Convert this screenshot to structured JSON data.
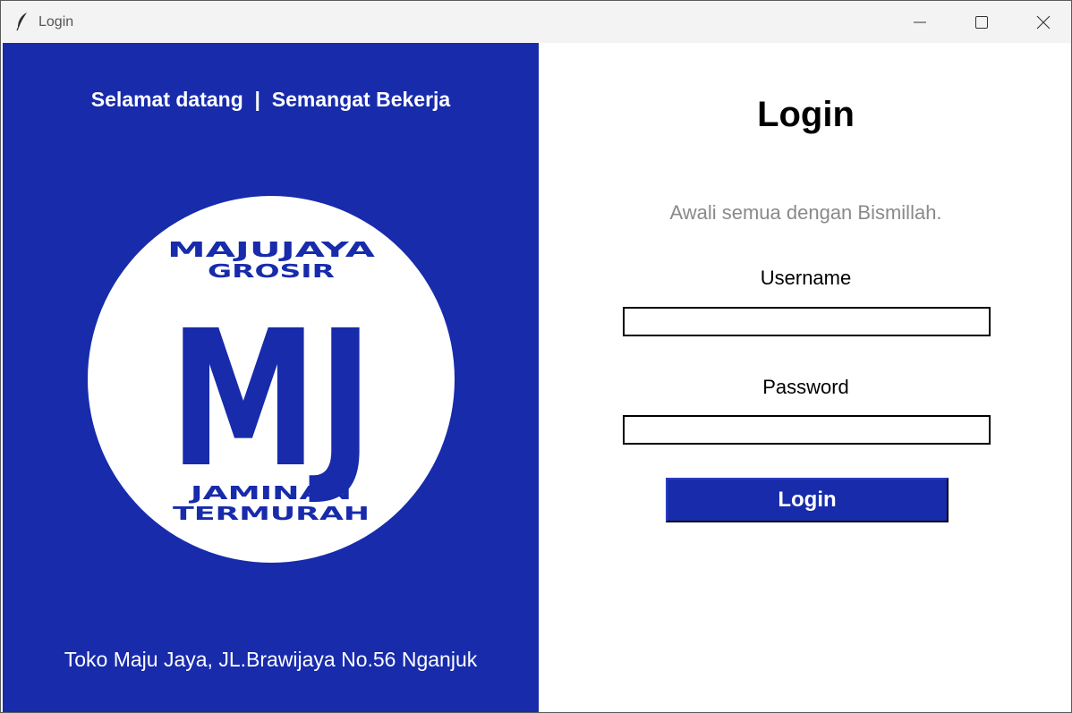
{
  "window": {
    "title": "Login",
    "controls": [
      "minimize-icon",
      "maximize-icon",
      "close-icon"
    ]
  },
  "left_panel": {
    "background": "#172bab",
    "welcome_text": "Selamat datang  |  Semangat Bekerja",
    "logo": {
      "line1": "MAJUJAYA",
      "line2": "GROSIR",
      "monogram": "MJ",
      "line3": "JAMINAN",
      "line4": "TERMURAH",
      "color": "#172bab"
    },
    "address": "Toko Maju Jaya, JL.Brawijaya No.56 Nganjuk"
  },
  "right_panel": {
    "heading": "Login",
    "subtitle": "Awali semua dengan Bismillah.",
    "username_label": "Username",
    "username_value": "",
    "password_label": "Password",
    "password_value": "",
    "login_button_label": "Login",
    "button_color": "#172bab"
  }
}
